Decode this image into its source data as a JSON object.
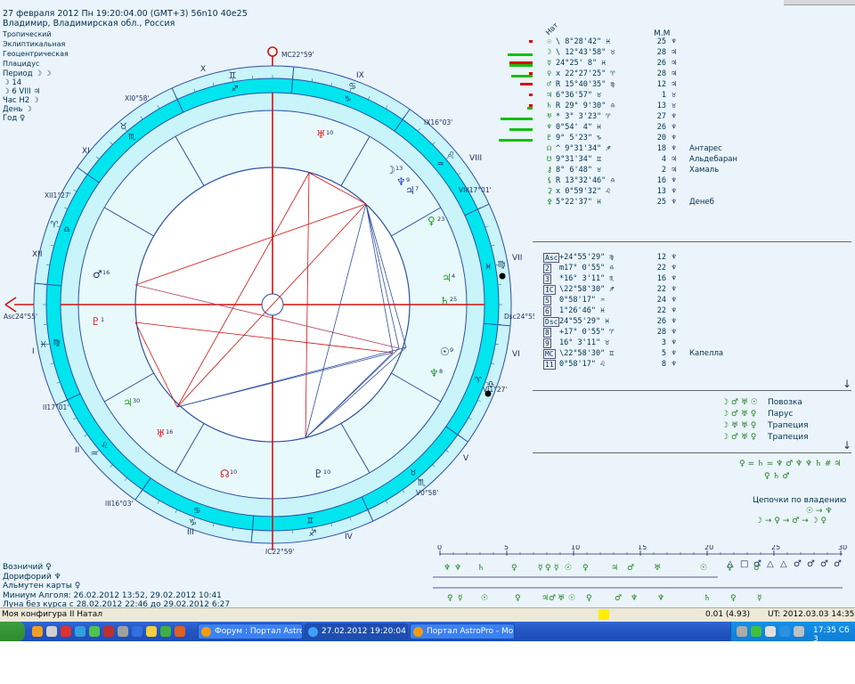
{
  "header": {
    "line1": "27 февраля 2012  Пн  19:20:04.00 (GMT+3) 56n10  40e25",
    "line2": "Владимир, Владимирская обл., Россия"
  },
  "settings": [
    "Тропический",
    "Эклиптикальная",
    "Геоцентрическая",
    "Плацидус"
  ],
  "info": [
    {
      "label": "Период",
      "value": "☽ ☽"
    },
    {
      "label": "☽",
      "value": "14"
    },
    {
      "label": "☽",
      "value": "6 VIII ♃"
    },
    {
      "label": "Час Н2",
      "value": "☽"
    },
    {
      "label": "День",
      "value": "☽"
    },
    {
      "label": "Год",
      "value": "♀"
    }
  ],
  "wheel": {
    "signs": [
      "♈",
      "♉",
      "♊",
      "♋",
      "♌",
      "♍",
      "♎",
      "♏",
      "♐",
      "♑",
      "♒",
      "♓"
    ],
    "houses": [
      "I",
      "II",
      "III",
      "IV",
      "V",
      "VI",
      "VII",
      "VIII",
      "IX",
      "X",
      "XI",
      "XII"
    ],
    "cusp_labels": [
      {
        "text": "MC22°59'"
      },
      {
        "text": "IX16°03'"
      },
      {
        "text": "VIII17°01'"
      },
      {
        "text": "Dsc24°55'"
      },
      {
        "text": "VI1°27'"
      },
      {
        "text": "V0°58'"
      },
      {
        "text": "IC22°59'"
      },
      {
        "text": "III16°03'"
      },
      {
        "text": "II17°01'"
      },
      {
        "text": "Asc24°55'"
      },
      {
        "text": "XII1°27'"
      },
      {
        "text": "XI0°58'"
      }
    ],
    "planets_in_chart": [
      {
        "glyph": "♅",
        "deg": "10"
      },
      {
        "glyph": "☽",
        "deg": "13"
      },
      {
        "glyph": "♆",
        "deg": "9"
      },
      {
        "glyph": "♃",
        "deg": "7"
      },
      {
        "glyph": "♀",
        "deg": "23"
      },
      {
        "glyph": "♃",
        "deg": "4"
      },
      {
        "glyph": "♄",
        "deg": "25"
      },
      {
        "glyph": "☉",
        "deg": "9"
      },
      {
        "glyph": "♆",
        "deg": "8"
      },
      {
        "glyph": "♇",
        "deg": "10"
      },
      {
        "glyph": "☊",
        "deg": "10"
      },
      {
        "glyph": "♅",
        "deg": "16"
      },
      {
        "glyph": "♃",
        "deg": "30"
      },
      {
        "glyph": "♇",
        "deg": "1"
      },
      {
        "glyph": "♂",
        "deg": "16"
      }
    ]
  },
  "mm_header": "М.М",
  "nat_label": "Нат",
  "planet_rows": [
    {
      "g": "☉",
      "pos": "\\  8°28'42\"  ♓",
      "mm": "25",
      "s": "♆"
    },
    {
      "g": "☽",
      "pos": "\\ 12°43'58\"  ♉",
      "mm": "28",
      "s": "♃"
    },
    {
      "g": "☿",
      "pos": "  24°25' 8\"  ♓",
      "mm": "26",
      "s": "♃"
    },
    {
      "g": "♀",
      "pos": "x 22°27'25\"  ♈",
      "mm": "28",
      "s": "♃"
    },
    {
      "g": "♂",
      "pos": "R 15°40'35\"  ♍",
      "mm": "12",
      "s": "♃"
    },
    {
      "g": "♃",
      "pos": "   6°36'57\"  ♉",
      "mm": "1",
      "s": "♉"
    },
    {
      "g": "♄",
      "pos": "R 29° 9'30\"  ♎",
      "mm": "13",
      "s": "♉"
    },
    {
      "g": "♅",
      "pos": "*  3° 3'23\"  ♈",
      "mm": "27",
      "s": "♆"
    },
    {
      "g": "♆",
      "pos": "   0°54' 4\"  ♓",
      "mm": "26",
      "s": "♆"
    },
    {
      "g": "♇",
      "pos": "   9° 5'23\"  ♑",
      "mm": "20",
      "s": "♆"
    },
    {
      "g": "☊",
      "pos": "^  9°31'34\"  ♐",
      "mm": "18",
      "s": "♆",
      "star": "Антарес"
    },
    {
      "g": "☋",
      "pos": "   9°31'34\"  ♊",
      "mm": "4",
      "s": "♃",
      "star": "Альдебаран"
    },
    {
      "g": "⚷",
      "pos": "   8° 6'48\"  ♉",
      "mm": "2",
      "s": "♃",
      "star": "Хамаль"
    },
    {
      "g": "⚸",
      "pos": "R 13°32'46\"  ♎",
      "mm": "16",
      "s": "♆"
    },
    {
      "g": "⚳",
      "pos": "x  0°59'32\"  ♌",
      "mm": "13",
      "s": "♆"
    },
    {
      "g": "⚴",
      "pos": "   5°22'37\"  ♓",
      "mm": "25",
      "s": "♆",
      "star": "Денеб"
    }
  ],
  "cusp_rows": [
    {
      "g": "Asc",
      "pos": "+24°55'29\" ♍",
      "mm": "12",
      "s": "♆"
    },
    {
      "g": "2",
      "pos": " m17° 0'55\" ♎",
      "mm": "22",
      "s": "♆"
    },
    {
      "g": "3",
      "pos": " *16° 3'11\" ♏",
      "mm": "16",
      "s": "♆"
    },
    {
      "g": "IC",
      "pos": "\\22°58'30\" ♐",
      "mm": "22",
      "s": "♆"
    },
    {
      "g": "5",
      "pos": "   0°58'17\" ♒",
      "mm": "24",
      "s": "♆"
    },
    {
      "g": "6",
      "pos": "   1°26'46\" ♓",
      "mm": "22",
      "s": "♆"
    },
    {
      "g": "Dsc",
      "pos": " 24°55'29\" ♓",
      "mm": "26",
      "s": "♆"
    },
    {
      "g": "8",
      "pos": " +17° 0'55\" ♈",
      "mm": "28",
      "s": "♆"
    },
    {
      "g": "9",
      "pos": "  16° 3'11\" ♉",
      "mm": "3",
      "s": "♆",
      "star": ""
    },
    {
      "g": "MC",
      "pos": " \\22°58'30\" ♊",
      "mm": "5",
      "s": "♆",
      "star": "Капелла"
    },
    {
      "g": "11",
      "pos": "   0°58'17\" ♌",
      "mm": "8",
      "s": "♆"
    }
  ],
  "configs": [
    {
      "g": "☽ ♂ ♅ ☉",
      "name": "Повозка"
    },
    {
      "g": "☽ ♂ ♅ ♀",
      "name": "Парус"
    },
    {
      "g": "☽ ♅ ♅ ♀",
      "name": "Трапеция"
    },
    {
      "g": "☽ ♂ ♅ ♀",
      "name": "Трапеция"
    }
  ],
  "equalities": "♀ = ♄ = ♆ ♂ ♆ ♆ ♄ # ♃",
  "equalities2": "♀ ♄ ♂",
  "chains_title": "Цепочки по владению",
  "chains1": "☉ → ♆",
  "chains2": "☽ → ♀ → ♂ → ☽ ♀",
  "axis": {
    "ticks": [
      "0",
      "5",
      "10",
      "15",
      "20",
      "25",
      "30"
    ]
  },
  "lower": [
    {
      "label": "Возничий",
      "value": "♀"
    },
    {
      "label": "Дорифорий",
      "value": "♆"
    },
    {
      "label": "Альмутен карты",
      "value": "♀"
    },
    {
      "label": "Миниум Алголя:",
      "value": "26.02.2012 13:52,  29.02.2012 10:41"
    },
    {
      "label": "Луна без курса с",
      "value": "28.02.2012 22:46 до 29.02.2012   6:27"
    }
  ],
  "status": {
    "left": "Моя конфигура II Натал",
    "mid": "0.01 (4.93)",
    "right": "UT: 2012.03.03 14:35:42"
  },
  "taskbar": {
    "items": [
      "Форум : Портал Astro...",
      "27.02.2012  19:20:04",
      "Портал AstroPro - Mo..."
    ],
    "time": "17:35 Сб 3"
  },
  "colors": {
    "ring": "#00e5ee",
    "ring_dark": "#20c8e0",
    "line": "#3050a0",
    "red": "#d01010",
    "green": "#10c010",
    "text": "#003050"
  }
}
